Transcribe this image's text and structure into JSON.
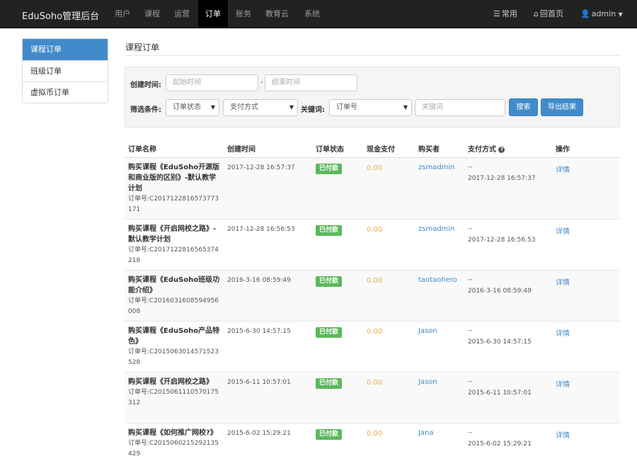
{
  "nav": {
    "brand": "EduSoho管理后台",
    "items": [
      "用户",
      "课程",
      "运营",
      "订单",
      "账务",
      "教育云",
      "系统"
    ],
    "active": "订单",
    "right": {
      "common": "常用",
      "home": "回首页",
      "user": "admin"
    }
  },
  "sidebar": {
    "items": [
      "课程订单",
      "班级订单",
      "虚拟币订单"
    ]
  },
  "page": {
    "title": "课程订单"
  },
  "filter": {
    "created_label": "创建时间:",
    "start_placeholder": "起始时间",
    "separator": "-",
    "end_placeholder": "结束时间",
    "condition_label": "筛选条件:",
    "status_select": "订单状态",
    "payment_select": "支付方式",
    "keyword_label": "关键词:",
    "keyword_type_select": "订单号",
    "keyword_placeholder": "关键词",
    "search_button": "搜索",
    "export_button": "导出结果"
  },
  "table": {
    "headers": [
      "订单名称",
      "创建时间",
      "订单状态",
      "现金支付",
      "购买者",
      "支付方式",
      "操作"
    ],
    "rows": [
      {
        "name": "购买课程《EduSoho开源版和商业版的区别》-默认教学计划",
        "sn_label": "订单号:",
        "sn": "C2017122816573773171",
        "created": "2017-12-28 16:57:37",
        "status": "已付款",
        "cash": "0.00",
        "buyer": "zsmadmin",
        "pay_method": "--",
        "pay_time": "2017-12-28 16:57:37",
        "action": "详情"
      },
      {
        "name": "购买课程《开启网校之路》-默认教学计划",
        "sn_label": "订单号:",
        "sn": "C2017122816565374218",
        "created": "2017-12-28 16:56:53",
        "status": "已付款",
        "cash": "0.00",
        "buyer": "zsmadmin",
        "pay_method": "--",
        "pay_time": "2017-12-28 16:56:53",
        "action": "详情"
      },
      {
        "name": "购买课程《EduSoho班级功能介绍》",
        "sn_label": "订单号:",
        "sn": "C2016031608594956008",
        "created": "2016-3-16 08:59:49",
        "status": "已付款",
        "cash": "0.00",
        "buyer": "taotaohero",
        "pay_method": "--",
        "pay_time": "2016-3-16 08:59:49",
        "action": "详情"
      },
      {
        "name": "购买课程《EduSoho产品特色》",
        "sn_label": "订单号:",
        "sn": "C2015063014571523528",
        "created": "2015-6-30 14:57:15",
        "status": "已付款",
        "cash": "0.00",
        "buyer": "Jason",
        "pay_method": "--",
        "pay_time": "2015-6-30 14:57:15",
        "action": "详情"
      },
      {
        "name": "购买课程《开启网校之路》",
        "sn_label": "订单号:",
        "sn": "C2015061110570175312",
        "created": "2015-6-11 10:57:01",
        "status": "已付款",
        "cash": "0.00",
        "buyer": "Jason",
        "pay_method": "--",
        "pay_time": "2015-6-11 10:57:01",
        "action": "详情"
      },
      {
        "name": "购买课程《如何推广网校?》",
        "sn_label": "订单号:",
        "sn": "C2015060215292135429",
        "created": "2015-6-02 15:29:21",
        "status": "已付款",
        "cash": "0.00",
        "buyer": "Jana",
        "pay_method": "--",
        "pay_time": "2015-6-02 15:29:21",
        "action": "详情"
      }
    ]
  },
  "colors": {
    "navbar": "#222222",
    "primary": "#428bca",
    "success": "#5cb85c",
    "amount": "#f0ad4e"
  }
}
